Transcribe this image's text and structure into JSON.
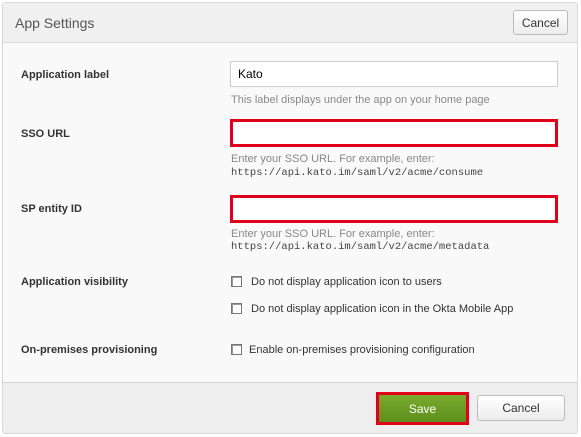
{
  "header": {
    "title": "App Settings",
    "cancel_label": "Cancel"
  },
  "form": {
    "app_label": {
      "label": "Application label",
      "value": "Kato",
      "help": "This label displays under the app on your home page"
    },
    "sso_url": {
      "label": "SSO URL",
      "value": "",
      "help": "Enter your SSO URL. For example, enter:",
      "example": "https://api.kato.im/saml/v2/acme/consume"
    },
    "sp_entity": {
      "label": "SP entity ID",
      "value": "",
      "help": "Enter your SSO URL. For example, enter:",
      "example": "https://api.kato.im/saml/v2/acme/metadata"
    },
    "visibility": {
      "label": "Application visibility",
      "options": [
        "Do not display application icon to users",
        "Do not display application icon in the Okta Mobile App"
      ]
    },
    "provisioning": {
      "label": "On-premises provisioning",
      "option": "Enable on-premises provisioning configuration"
    }
  },
  "footer": {
    "save_label": "Save",
    "cancel_label": "Cancel"
  }
}
